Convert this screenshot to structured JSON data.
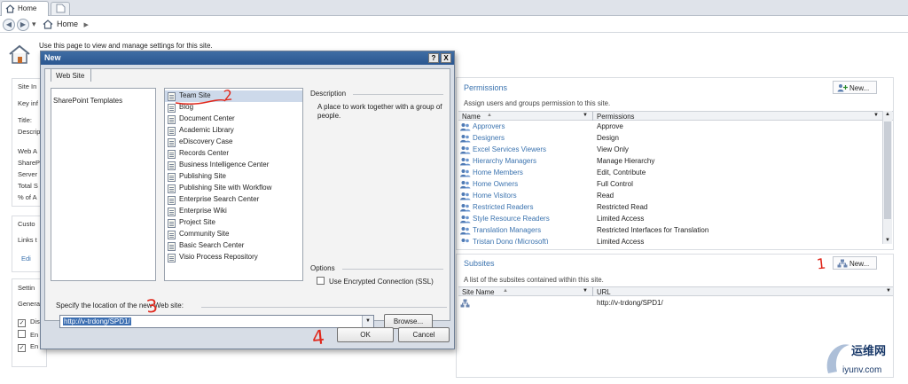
{
  "browser": {
    "tab_label": "Home",
    "crumb": "Home",
    "back": "◀",
    "forward": "▶",
    "dropdown": "▾",
    "crumb_arrow": "▶"
  },
  "page": {
    "description": "Use this page to view and manage settings for this site."
  },
  "left_panes": {
    "site_info_title": "Site In",
    "site_info_lines": [
      "Key inf",
      "Title:",
      "Descrip",
      "Web A",
      "ShareP",
      "Server",
      "Total S",
      "% of A"
    ],
    "customize_title": "Custo",
    "customize_lines": [
      "Links t",
      "Edi"
    ],
    "settings_title": "Settin",
    "settings_lines": [
      "Genera",
      "Dis",
      "En",
      "En"
    ]
  },
  "permissions": {
    "title": "Permissions",
    "new_button": "New...",
    "description": "Assign users and groups permission to this site.",
    "col_name": "Name",
    "col_permissions": "Permissions",
    "rows": [
      {
        "name": "Approvers",
        "perm": "Approve"
      },
      {
        "name": "Designers",
        "perm": "Design"
      },
      {
        "name": "Excel Services Viewers",
        "perm": "View Only"
      },
      {
        "name": "Hierarchy Managers",
        "perm": "Manage Hierarchy"
      },
      {
        "name": "Home Members",
        "perm": "Edit, Contribute"
      },
      {
        "name": "Home Owners",
        "perm": "Full Control"
      },
      {
        "name": "Home Visitors",
        "perm": "Read"
      },
      {
        "name": "Restricted Readers",
        "perm": "Restricted Read"
      },
      {
        "name": "Style Resource Readers",
        "perm": "Limited Access"
      },
      {
        "name": "Translation Managers",
        "perm": "Restricted Interfaces for Translation"
      },
      {
        "name": "Tristan Dong (Microsoft)",
        "perm": "Limited Access"
      }
    ]
  },
  "subsites": {
    "title": "Subsites",
    "new_button": "New...",
    "description": "A list of the subsites contained within this site.",
    "col_name": "Site Name",
    "col_url": "URL",
    "rows": [
      {
        "name": "",
        "url": "http://v-trdong/SPD1/"
      }
    ]
  },
  "dialog": {
    "title": "New",
    "help_btn": "?",
    "close_btn": "X",
    "tab": "Web Site",
    "category": "SharePoint Templates",
    "templates": [
      "Team Site",
      "Blog",
      "Document Center",
      "Academic Library",
      "eDiscovery Case",
      "Records Center",
      "Business Intelligence Center",
      "Publishing Site",
      "Publishing Site with Workflow",
      "Enterprise Search Center",
      "Enterprise Wiki",
      "Project Site",
      "Community Site",
      "Basic Search Center",
      "Visio Process Repository"
    ],
    "selected_template": "Team Site",
    "description_label": "Description",
    "description_text": "A place to work together with a group of people.",
    "options_label": "Options",
    "encrypted_label": "Use Encrypted Connection (SSL)",
    "location_label": "Specify the location of the new Web site:",
    "location_value": "http://v-trdong/SPD1/",
    "browse_button": "Browse...",
    "ok_button": "OK",
    "cancel_button": "Cancel"
  },
  "annotations": [
    "1",
    "2",
    "3",
    "4"
  ],
  "watermark": {
    "text": "运维网",
    "url": "iyunv.com"
  },
  "colors": {
    "link": "#3b73af",
    "title_bar": "#2a5690",
    "annotation": "#e0271b"
  }
}
